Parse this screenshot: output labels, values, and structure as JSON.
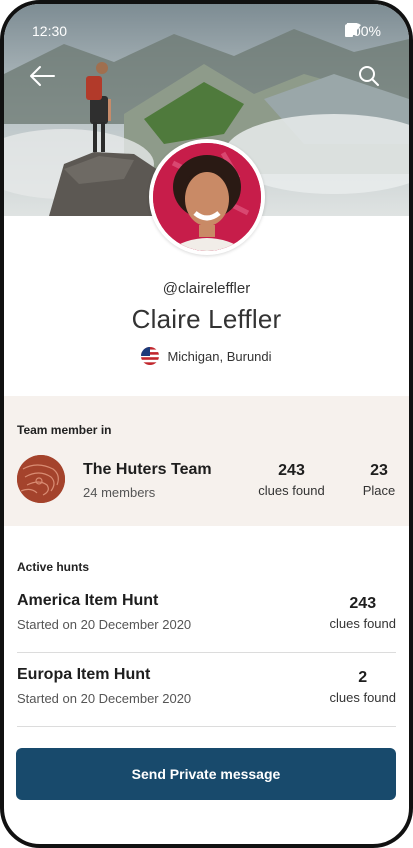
{
  "status": {
    "time": "12:30",
    "battery": "100%"
  },
  "profile": {
    "handle": "@claireleffler",
    "name": "Claire Leffler",
    "location": "Michigan, Burundi"
  },
  "team": {
    "section_title": "Team member in",
    "name": "The Huters Team",
    "members": "24 members",
    "clues": {
      "value": "243",
      "label": "clues found"
    },
    "place": {
      "value": "23",
      "label": "Place"
    }
  },
  "hunts": {
    "section_title": "Active hunts",
    "items": [
      {
        "name": "America Item Hunt",
        "started": "Started on 20 December 2020",
        "value": "243",
        "label": "clues found"
      },
      {
        "name": "Europa Item Hunt",
        "started": "Started on 20 December 2020",
        "value": "2",
        "label": "clues found"
      }
    ]
  },
  "actions": {
    "message_button": "Send Private message"
  },
  "icons": {
    "back": "arrow-left-icon",
    "search": "search-icon",
    "wifi": "wifi-icon",
    "signal": "signal-icon",
    "battery": "battery-icon"
  },
  "colors": {
    "primary": "#184a6c",
    "team_background": "#f6f1ed",
    "avatar_accent": "#c71d4a",
    "team_logo": "#a4432c"
  }
}
